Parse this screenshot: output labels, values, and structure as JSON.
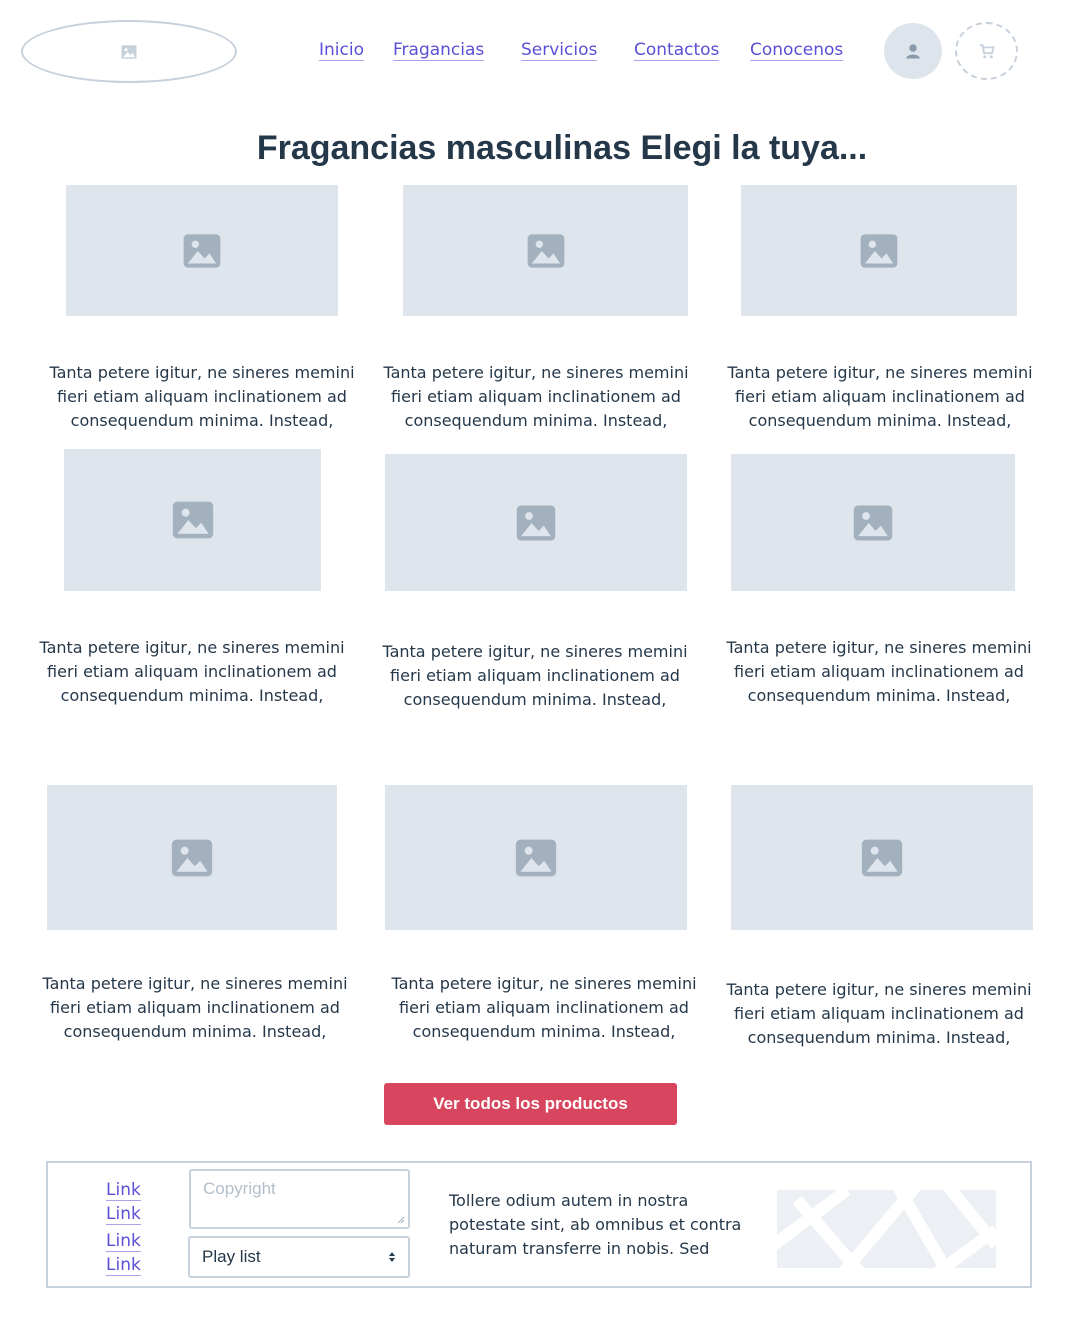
{
  "header": {
    "logo_icon": "image-icon",
    "nav": [
      "Inicio",
      "Fragancias",
      "Servicios",
      "Contactos",
      "Conocenos"
    ],
    "user_icon": "user-icon",
    "cart_icon": "cart-icon"
  },
  "main": {
    "title": "Fragancias masculinas Elegi la tuya...",
    "products": [
      {
        "caption": "Tanta petere igitur, ne sineres memini fieri etiam aliquam inclinationem ad consequendum minima. Instead,"
      },
      {
        "caption": "Tanta petere igitur, ne sineres memini fieri etiam aliquam inclinationem ad consequendum minima. Instead,"
      },
      {
        "caption": "Tanta petere igitur, ne sineres memini fieri etiam aliquam inclinationem ad consequendum minima. Instead,"
      },
      {
        "caption": "Tanta petere igitur, ne sineres memini fieri etiam aliquam inclinationem ad consequendum minima. Instead,"
      },
      {
        "caption": "Tanta petere igitur, ne sineres memini fieri etiam aliquam inclinationem ad consequendum minima. Instead,"
      },
      {
        "caption": "Tanta petere igitur, ne sineres memini fieri etiam aliquam inclinationem ad consequendum minima. Instead,"
      },
      {
        "caption": "Tanta petere igitur, ne sineres memini fieri etiam aliquam inclinationem ad consequendum minima. Instead,"
      },
      {
        "caption": "Tanta petere igitur, ne sineres memini fieri etiam aliquam inclinationem ad consequendum minima. Instead,"
      },
      {
        "caption": "Tanta petere igitur, ne sineres memini fieri etiam aliquam inclinationem ad consequendum minima. Instead,"
      }
    ],
    "cta_label": "Ver todos los productos"
  },
  "footer": {
    "links": [
      "Link",
      "Link",
      "Link",
      "Link"
    ],
    "copyright_placeholder": "Copyright",
    "select_value": "Play list",
    "text": "Tollere odium autem in nostra potestate sint, ab omnibus et contra naturam transferre in nobis. Sed"
  },
  "colors": {
    "link": "#5a4fd6",
    "placeholder_bg": "#dfe5ed",
    "placeholder_icon": "#a3b1bf",
    "cta": "#d7455e",
    "border": "#c7d1db"
  }
}
